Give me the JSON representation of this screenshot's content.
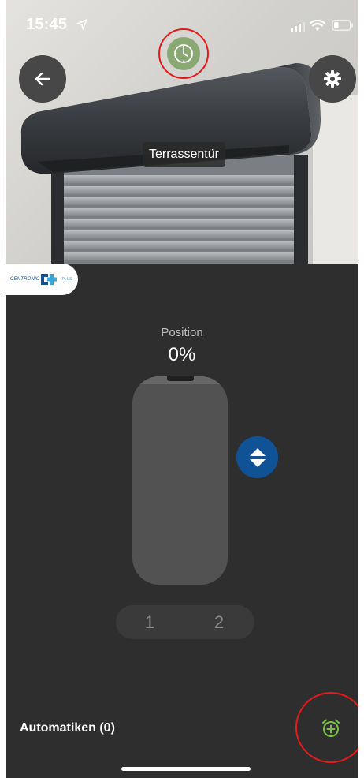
{
  "status_bar": {
    "time": "15:45",
    "battery_level": 0.3
  },
  "hero": {
    "device_name": "Terrassentür"
  },
  "brand": {
    "name": "CENTRONIC",
    "suffix": "PLUS"
  },
  "position": {
    "label": "Position",
    "value": "0%",
    "level": 0
  },
  "presets": [
    "1",
    "2"
  ],
  "automations": {
    "label": "Automatiken (0)"
  },
  "icons": {
    "back": "arrow-left-icon",
    "settings": "gear-icon",
    "clock": "clock-icon",
    "updown": "up-down-icon",
    "add_alarm": "alarm-add-icon"
  },
  "colors": {
    "accent_blue": "#0f5396",
    "clock_green": "#8aa874",
    "add_green": "#7bc043",
    "highlight_red": "#e41b1b",
    "background": "#2e2e2e"
  }
}
